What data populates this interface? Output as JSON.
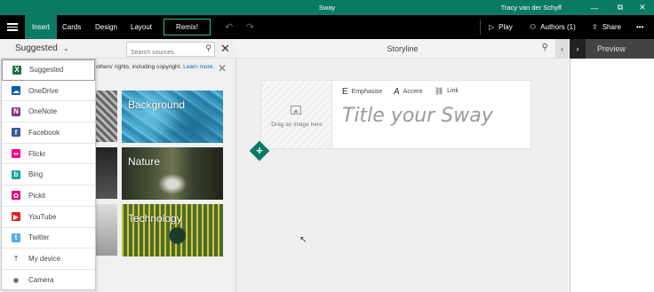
{
  "titlebar": {
    "title": "Sway",
    "user": "Tracy van der Schyff",
    "controls": {
      "minimize": "—",
      "restore": "⧉",
      "close": "✕"
    }
  },
  "toolbar": {
    "tabs": [
      "Insert",
      "Cards",
      "Design",
      "Layout"
    ],
    "remix_label": "Remix!",
    "undo": "↶",
    "redo": "↷",
    "play_label": "Play",
    "authors_label": "Authors (1)",
    "share_label": "Share",
    "more": "•••",
    "accent": "#0b7a64"
  },
  "left_pane": {
    "source_label": "Suggested",
    "search_placeholder": "Search sources",
    "notice_text": "others' rights, including copyright.",
    "notice_link": "Learn more.",
    "tiles": [
      "Background",
      "Nature",
      "Technology"
    ],
    "sources": [
      {
        "label": "Suggested",
        "icon": "excel-icon",
        "glyph": "X",
        "color": "#1e7145",
        "selected": true
      },
      {
        "label": "OneDrive",
        "icon": "onedrive-icon",
        "glyph": "☁",
        "color": "#0a5bb5"
      },
      {
        "label": "OneNote",
        "icon": "onenote-icon",
        "glyph": "N",
        "color": "#80397b"
      },
      {
        "label": "Facebook",
        "icon": "facebook-icon",
        "glyph": "f",
        "color": "#3b5998"
      },
      {
        "label": "Flickr",
        "icon": "flickr-icon",
        "glyph": "••",
        "color": "#ff0084"
      },
      {
        "label": "Bing",
        "icon": "bing-icon",
        "glyph": "b",
        "color": "#13a89e"
      },
      {
        "label": "Pickit",
        "icon": "pickit-icon",
        "glyph": "✿",
        "color": "#e6007e"
      },
      {
        "label": "YouTube",
        "icon": "youtube-icon",
        "glyph": "▶",
        "color": "#e62117"
      },
      {
        "label": "Twitter",
        "icon": "twitter-icon",
        "glyph": "t",
        "color": "#55acee"
      },
      {
        "label": "My device",
        "icon": "upload-icon",
        "glyph": "⇡",
        "color": "#666666"
      },
      {
        "label": "Camera",
        "icon": "camera-icon",
        "glyph": "◉",
        "color": "#666666"
      }
    ]
  },
  "storyline": {
    "header": "Storyline",
    "image_drop_text": "Drag an image here",
    "format_buttons": [
      {
        "glyph": "E",
        "label": "Emphasise"
      },
      {
        "glyph": "A",
        "label": "Accent"
      },
      {
        "glyph": "⛓",
        "label": "Link"
      }
    ],
    "title_placeholder": "Title your Sway",
    "add_card": "+"
  },
  "preview": {
    "label": "Preview"
  }
}
